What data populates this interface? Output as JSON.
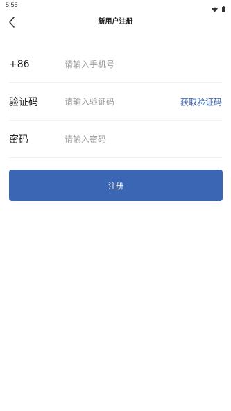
{
  "status_bar": {
    "time": "5:55",
    "icons": [
      "wifi-icon",
      "battery-icon"
    ]
  },
  "header": {
    "title": "新用户注册",
    "back_icon": "chevron-left-icon"
  },
  "form": {
    "phone": {
      "label": "+86",
      "placeholder": "请输入手机号",
      "value": ""
    },
    "code": {
      "label": "验证码",
      "placeholder": "请输入验证码",
      "value": "",
      "action_label": "获取验证码"
    },
    "password": {
      "label": "密码",
      "placeholder": "请输入密码",
      "value": ""
    }
  },
  "submit": {
    "label": "注册"
  },
  "colors": {
    "accent": "#3a66b3",
    "background": "#ffffff",
    "text": "#222222",
    "placeholder": "#9a9a9a"
  }
}
